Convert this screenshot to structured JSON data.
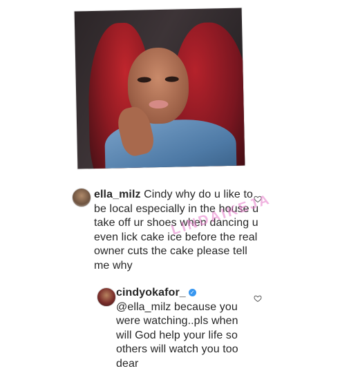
{
  "post": {
    "image_alt": "Selfie of a woman with long red hair in a denim shirt"
  },
  "watermark": "LINDAIKEJA",
  "comments": [
    {
      "username": "ella_milz",
      "text": "Cindy why do u like to be local especially in the house u take off ur shoes when dancing u even lick cake ice before the real owner cuts the cake please tell me why"
    },
    {
      "username": "cindyokafor_",
      "verified": true,
      "verified_mark": "✓",
      "text": "@ella_milz because you were watching..pls when will God help your life so others will watch you too dear"
    }
  ],
  "colors": {
    "verified_badge": "#3897f0",
    "text": "#262626",
    "watermark": "#e678c8"
  }
}
